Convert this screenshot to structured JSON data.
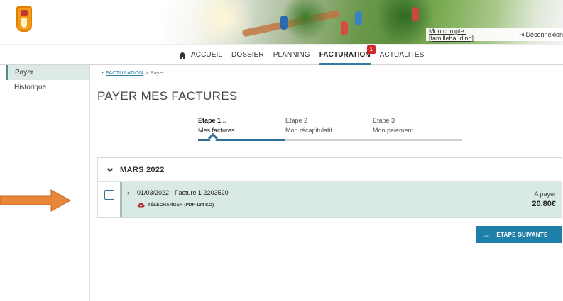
{
  "header": {
    "account_link": "Mon compte: [famillebaudino]",
    "logout_label": "Déconnexion"
  },
  "nav": {
    "items": [
      {
        "label": "ACCUEIL"
      },
      {
        "label": "DOSSIER"
      },
      {
        "label": "PLANNING"
      },
      {
        "label": "FACTURATION",
        "badge": "1",
        "active": true
      },
      {
        "label": "ACTUALITÉS"
      }
    ]
  },
  "sidebar": {
    "items": [
      {
        "label": "Payer",
        "active": true
      },
      {
        "label": "Historique"
      }
    ]
  },
  "breadcrumb": {
    "link": "FACTURATION",
    "current": "Payer",
    "separator": ">"
  },
  "page": {
    "title": "PAYER MES FACTURES"
  },
  "steps": [
    {
      "num": "Etape 1",
      "label": "Mes factures",
      "active": true
    },
    {
      "num": "Etape 2",
      "label": "Mon récapitulatif"
    },
    {
      "num": "Etape 3",
      "label": "Mon paiement"
    }
  ],
  "step_progress": 0.33,
  "invoices": {
    "month": "MARS 2022",
    "rows": [
      {
        "title": "01/03/2022 - Facture 1 2203520",
        "download": "TÉLÉCHARGER (PDF-134 KO)",
        "status": "A payer",
        "amount": "20.80€"
      }
    ]
  },
  "actions": {
    "next_step": "ETAPE SUIVANTE"
  },
  "colors": {
    "accent": "#1e7fa8",
    "row_highlight": "#d9e9e5",
    "badge": "#d22a2a",
    "annotation_arrow": "#e8873a"
  }
}
